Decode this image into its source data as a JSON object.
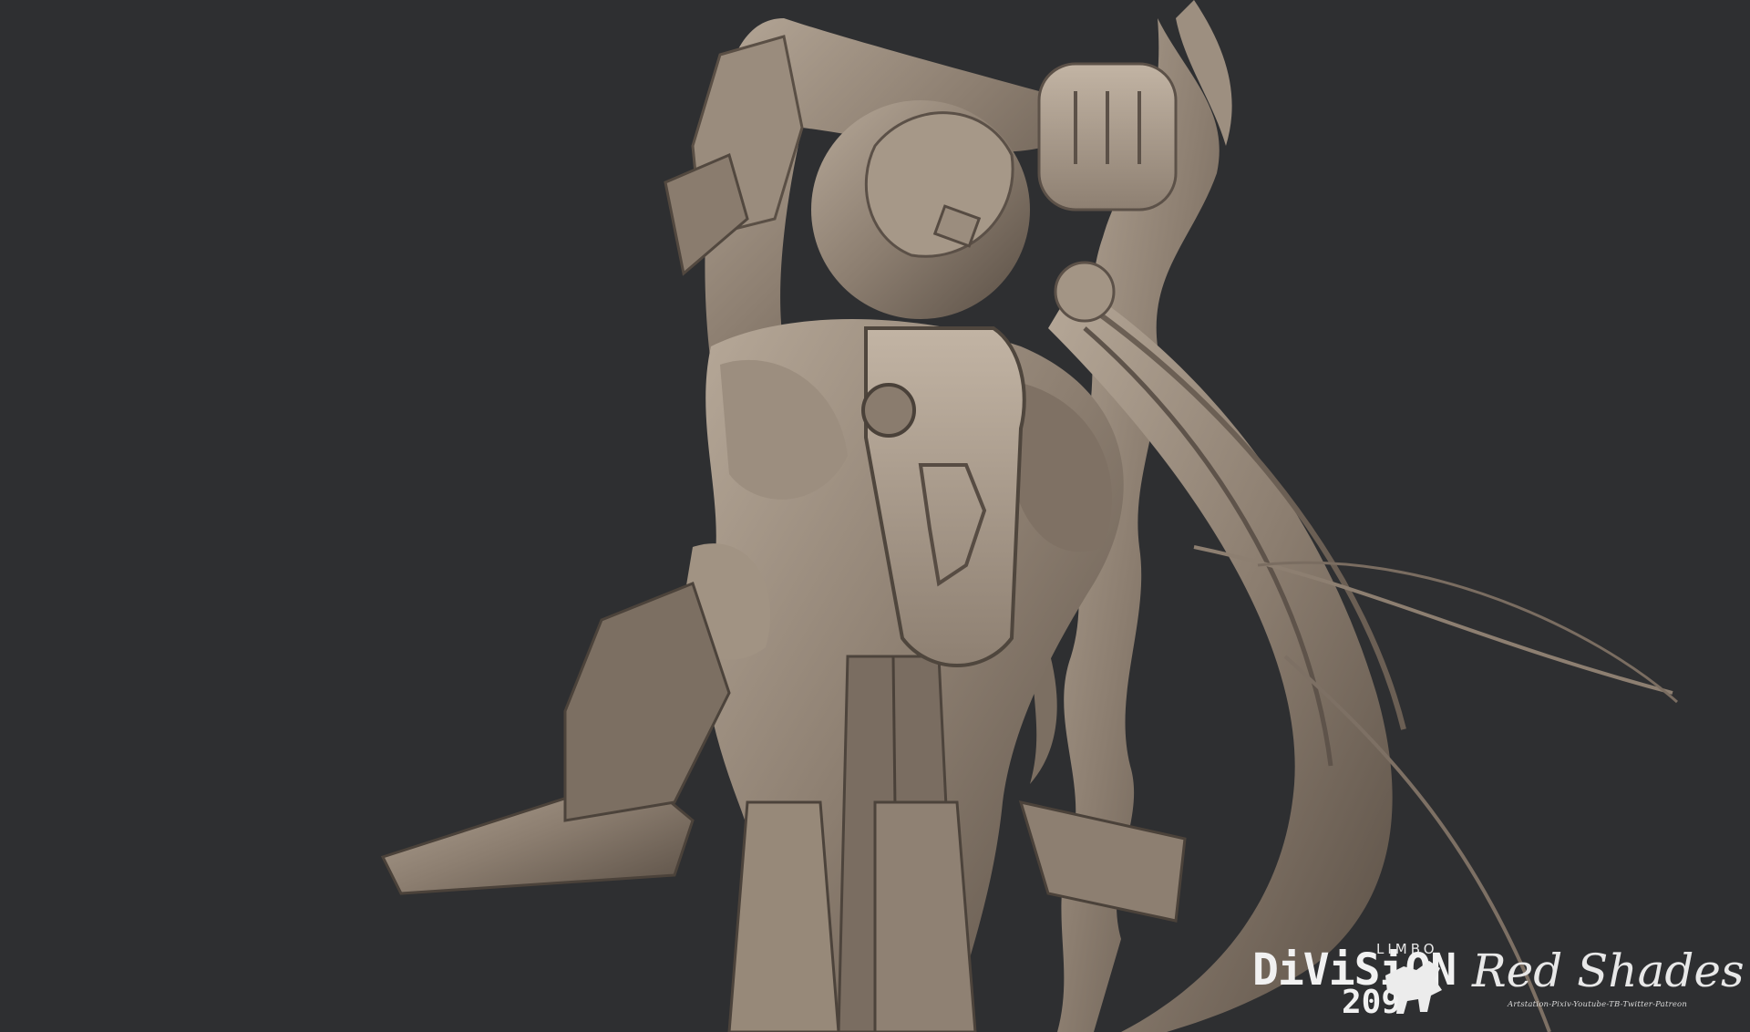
{
  "image": {
    "subject": "3D sculpt render",
    "background_color": "#2e2f31",
    "clay_color": "#8a7c6e",
    "clay_highlight": "#b3a596",
    "clay_shadow": "#4a4139"
  },
  "watermark": {
    "limbo": "LIMBO",
    "division": "DiViSiON",
    "number": "209",
    "author": "Red Shades TD",
    "links": "Artstation-Pixiv-Youtube-TB-Twitter-Patreon"
  }
}
